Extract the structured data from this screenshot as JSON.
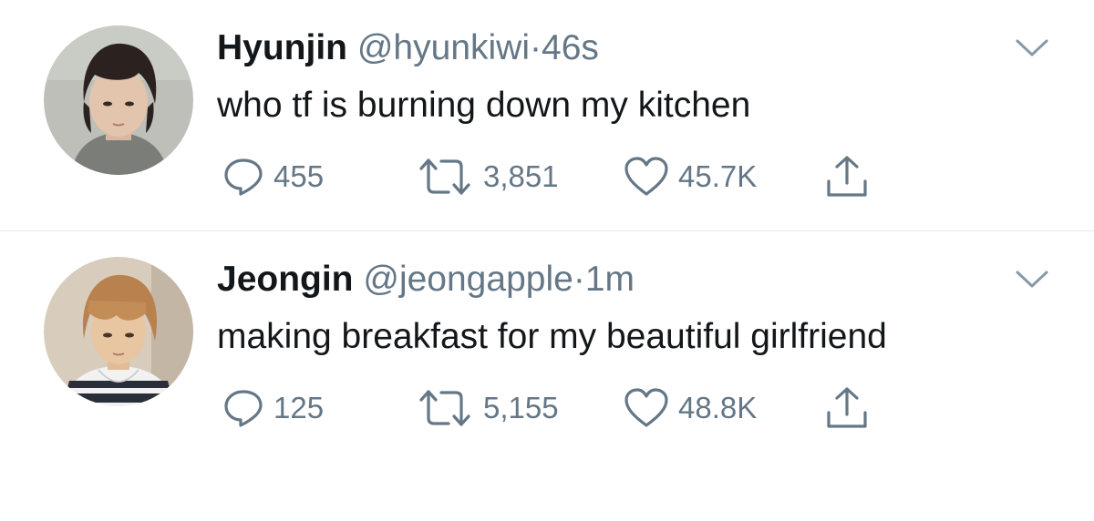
{
  "tweets": [
    {
      "name": "Hyunjin",
      "handle": "@hyunkiwi",
      "separator": "·",
      "time": "46s",
      "text": "who tf is burning down my kitchen",
      "replies": "455",
      "retweets": "3,851",
      "likes": "45.7K"
    },
    {
      "name": "Jeongin",
      "handle": "@jeongapple",
      "separator": "·",
      "time": "1m",
      "text": "making breakfast for my beautiful girlfriend",
      "replies": "125",
      "retweets": "5,155",
      "likes": "48.8K"
    }
  ],
  "icons": {
    "reply": "reply-icon",
    "retweet": "retweet-icon",
    "like": "heart-icon",
    "share": "share-icon",
    "caret": "chevron-down-icon"
  },
  "colors": {
    "text": "#14171a",
    "secondary": "#657786",
    "divider": "#e1e8ed"
  }
}
